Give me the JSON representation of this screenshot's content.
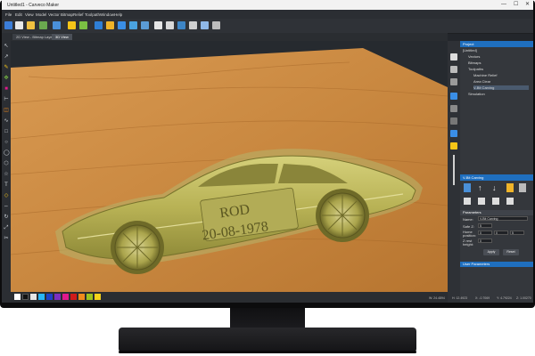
{
  "window": {
    "title": "Untitled1 - Carveco Maker",
    "controls": [
      "—",
      "☐",
      "✕"
    ]
  },
  "menu": [
    "File",
    "Edit",
    "View",
    "Model",
    "Vector",
    "Bitmap",
    "Relief",
    "Toolpath",
    "Window",
    "Help"
  ],
  "tabs": [
    {
      "label": "2D View - Bitmap Layer",
      "active": false
    },
    {
      "label": "3D View",
      "active": true
    }
  ],
  "model": {
    "engraving_line1": "ROD",
    "engraving_line2": "20-08-1978"
  },
  "palette": {
    "colors": [
      "#ffffff",
      "#111111",
      "#e6e6e6",
      "#29b6f6",
      "#1e40c8",
      "#7b2fbf",
      "#e0188c",
      "#d01a1a",
      "#f08a1c",
      "#9cc21e",
      "#f5d21a"
    ]
  },
  "project_panel": {
    "header": "Project",
    "items": [
      {
        "label": "[Untitled]",
        "indent": 0
      },
      {
        "label": "Vectors",
        "indent": 1
      },
      {
        "label": "Bitmaps",
        "indent": 1
      },
      {
        "label": "Toolpaths",
        "indent": 1
      },
      {
        "label": "Machine Relief",
        "indent": 2
      },
      {
        "label": "Area Clear",
        "indent": 2
      },
      {
        "label": "V-Bit Carving",
        "indent": 2,
        "selected": true
      },
      {
        "label": "Simulation",
        "indent": 1
      }
    ]
  },
  "carving_panel": {
    "header": "V-Bit Carving",
    "parameters_header": "Parameters",
    "name_label": "Name:",
    "name_value": "V-Bit Carving",
    "safe_z_label": "Safe Z:",
    "safe_z_value": "5",
    "home_label": "Home position:",
    "home_x": "0",
    "home_y": "0",
    "home_z": "5",
    "plunge_label": "Z rest height:",
    "plunge_value": "0",
    "apply_label": "Apply",
    "reset_label": "Reset",
    "user_params": "User Parameters"
  },
  "status": {
    "w": "W: 24.4894",
    "h": "H: 12.4923",
    "x": "X: -0.7069",
    "y": "Y: 4.79224",
    "z": "Z: 1.00270"
  }
}
